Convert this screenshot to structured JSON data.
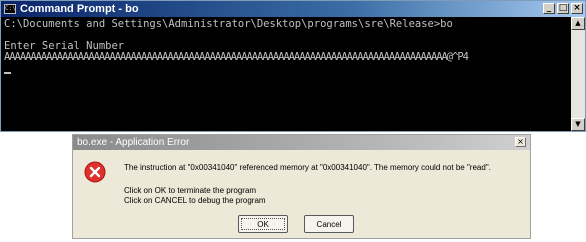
{
  "cmd_window": {
    "title": "Command Prompt - bo",
    "icon_label": "C:\\",
    "buttons": {
      "minimize": "_",
      "maximize": "□",
      "close": "×"
    },
    "lines": [
      "C:\\Documents and Settings\\Administrator\\Desktop\\programs\\sre\\Release>bo",
      "",
      "Enter Serial Number",
      "AAAAAAAAAAAAAAAAAAAAAAAAAAAAAAAAAAAAAAAAAAAAAAAAAAAAAAAAAAAAAAAAAAAAAAAAAAAAAAAAAAAA@^P4"
    ],
    "scroll": {
      "up": "▲",
      "down": "▼"
    }
  },
  "error_dialog": {
    "title": "bo.exe - Application Error",
    "close": "×",
    "message": "The instruction at \"0x00341040\" referenced memory at \"0x00341040\". The memory could not be \"read\".",
    "hint_ok": "Click on OK to terminate the program",
    "hint_cancel": "Click on CANCEL to debug the program",
    "ok_label": "OK",
    "cancel_label": "Cancel",
    "icon": "error-x-icon",
    "colors": {
      "icon_red": "#e0302a",
      "icon_border": "#a01818"
    }
  }
}
